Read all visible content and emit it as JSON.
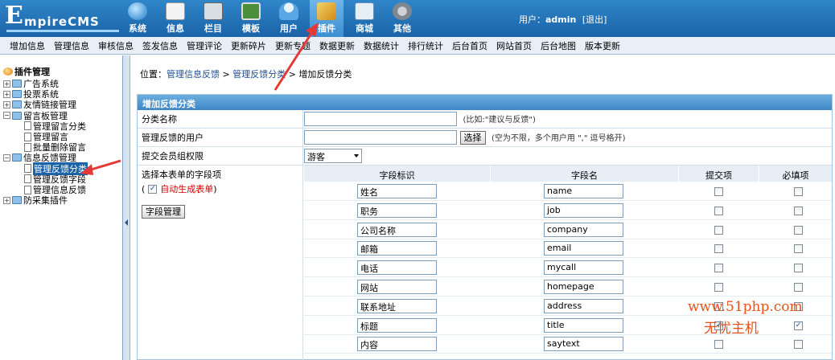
{
  "header": {
    "logo_big": "E",
    "logo_rest": "mpireCMS",
    "nav": [
      {
        "label": "系统",
        "icon": "globe-icon"
      },
      {
        "label": "信息",
        "icon": "document-icon"
      },
      {
        "label": "栏目",
        "icon": "folder-icon"
      },
      {
        "label": "模板",
        "icon": "template-icon"
      },
      {
        "label": "用户",
        "icon": "user-icon"
      },
      {
        "label": "插件",
        "icon": "plugin-icon",
        "active": true
      },
      {
        "label": "商城",
        "icon": "shop-icon"
      },
      {
        "label": "其他",
        "icon": "gear-icon"
      }
    ],
    "user_label": "用户：",
    "user_name": "admin",
    "logout": "[退出]"
  },
  "menubar": [
    "增加信息",
    "管理信息",
    "审核信息",
    "签发信息",
    "管理评论",
    "更新碎片",
    "更新专题",
    "数据更新",
    "数据统计",
    "排行统计",
    "后台首页",
    "网站首页",
    "后台地图",
    "版本更新"
  ],
  "tree": {
    "root": "插件管理",
    "items": [
      {
        "label": "广告系统",
        "level": 0
      },
      {
        "label": "投票系统",
        "level": 0
      },
      {
        "label": "友情链接管理",
        "level": 0
      },
      {
        "label": "留言板管理",
        "level": 0,
        "open": true
      },
      {
        "label": "管理留言分类",
        "level": 1
      },
      {
        "label": "管理留言",
        "level": 1
      },
      {
        "label": "批量删除留言",
        "level": 1
      },
      {
        "label": "信息反馈管理",
        "level": 0,
        "open": true
      },
      {
        "label": "管理反馈分类",
        "level": 1,
        "selected": true
      },
      {
        "label": "管理反馈字段",
        "level": 1
      },
      {
        "label": "管理信息反馈",
        "level": 1
      },
      {
        "label": "防采集插件",
        "level": 0
      }
    ]
  },
  "breadcrumb": {
    "prefix": "位置：",
    "link1": "管理信息反馈",
    "sep1": " > ",
    "link2": "管理反馈分类",
    "sep2": " > ",
    "current": "增加反馈分类"
  },
  "form": {
    "title": "增加反馈分类",
    "category_label": "分类名称",
    "category_value": "",
    "category_hint": "(比如:\"建议与反馈\")",
    "manager_label": "管理反馈的用户",
    "manager_value": "",
    "select_button": "选择",
    "manager_hint": "(空为不限，多个用户用 \",\" 逗号格开)",
    "group_label": "提交会员组权限",
    "group_value": "游客",
    "fields_label": "选择本表单的字段项",
    "auto_open": "(",
    "auto_label": "自动生成表单",
    "auto_close": ")",
    "field_manage_button": "字段管理",
    "col_field_id": "字段标识",
    "col_field_name": "字段名",
    "col_submit": "提交项",
    "col_required": "必填项",
    "fields": [
      {
        "label": "姓名",
        "name": "name",
        "submit": false,
        "required": false
      },
      {
        "label": "职务",
        "name": "job",
        "submit": false,
        "required": false
      },
      {
        "label": "公司名称",
        "name": "company",
        "submit": false,
        "required": false
      },
      {
        "label": "邮箱",
        "name": "email",
        "submit": false,
        "required": false
      },
      {
        "label": "电话",
        "name": "mycall",
        "submit": false,
        "required": false
      },
      {
        "label": "网站",
        "name": "homepage",
        "submit": false,
        "required": false
      },
      {
        "label": "联系地址",
        "name": "address",
        "submit": false,
        "required": false
      },
      {
        "label": "标题",
        "name": "title",
        "submit": true,
        "required": true
      },
      {
        "label": "内容",
        "name": "saytext",
        "submit": false,
        "required": false
      }
    ]
  },
  "watermark": {
    "line1": "www.51php.com",
    "line2": "无忧主机"
  },
  "colors": {
    "header": "#1b63a8",
    "accent": "#3f86c6",
    "annotation": "#e53935"
  }
}
